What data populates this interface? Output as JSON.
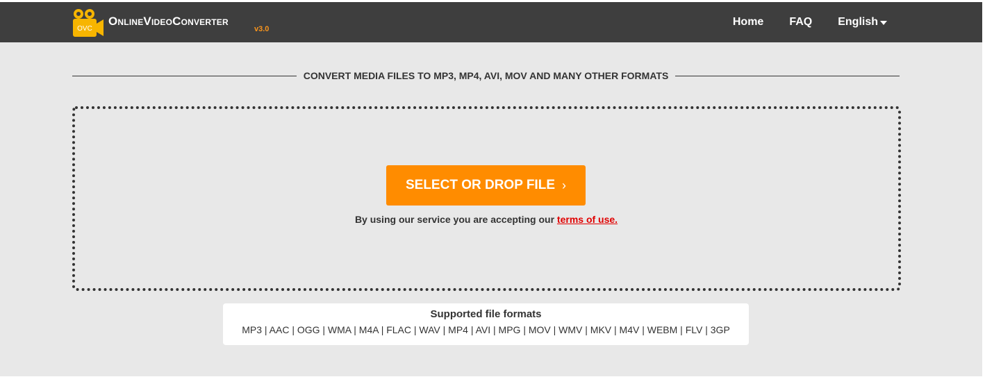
{
  "header": {
    "logo_icon": "film-camera-icon",
    "logo_icon_text": "OVC",
    "logo_text": "OnlineVideoConverter",
    "version": "v3.0",
    "nav": [
      {
        "label": "Home"
      },
      {
        "label": "FAQ"
      },
      {
        "label": "English",
        "icon": "caret-down-icon"
      }
    ]
  },
  "main": {
    "heading": "CONVERT MEDIA FILES TO MP3, MP4, AVI, MOV AND MANY OTHER FORMATS",
    "select_button": "SELECT OR DROP FILE",
    "select_button_icon": "chevron-right-icon",
    "terms_prefix": "By using our service you are accepting our",
    "terms_link": "terms of use."
  },
  "formats": {
    "title": "Supported file formats",
    "list": "MP3 | AAC | OGG | WMA | M4A | FLAC | WAV | MP4 | AVI | MPG | MOV | WMV | MKV | M4V | WEBM | FLV | 3GP"
  },
  "colors": {
    "navbar": "#3e3e3e",
    "accent": "#ff8c00",
    "link": "#e00000",
    "background": "#e8e8e8"
  }
}
